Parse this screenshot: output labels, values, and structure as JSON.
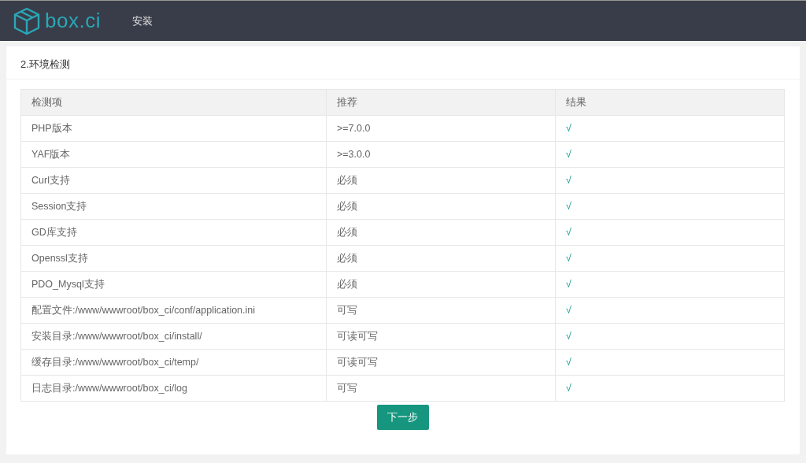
{
  "header": {
    "logo_text": "box.ci",
    "nav": [
      {
        "label": "安装"
      }
    ]
  },
  "panel": {
    "title": "2.环境检测",
    "table": {
      "columns": [
        "检测项",
        "推荐",
        "结果"
      ],
      "rows": [
        {
          "item": "PHP版本",
          "recommended": ">=7.0.0",
          "result": "√"
        },
        {
          "item": "YAF版本",
          "recommended": ">=3.0.0",
          "result": "√"
        },
        {
          "item": "Curl支持",
          "recommended": "必须",
          "result": "√"
        },
        {
          "item": "Session支持",
          "recommended": "必须",
          "result": "√"
        },
        {
          "item": "GD库支持",
          "recommended": "必须",
          "result": "√"
        },
        {
          "item": "Openssl支持",
          "recommended": "必须",
          "result": "√"
        },
        {
          "item": "PDO_Mysql支持",
          "recommended": "必须",
          "result": "√"
        },
        {
          "item": "配置文件:/www/wwwroot/box_ci/conf/application.ini",
          "recommended": "可写",
          "result": "√"
        },
        {
          "item": "安装目录:/www/wwwroot/box_ci/install/",
          "recommended": "可读可写",
          "result": "√"
        },
        {
          "item": "缓存目录:/www/wwwroot/box_ci/temp/",
          "recommended": "可读可写",
          "result": "√"
        },
        {
          "item": "日志目录:/www/wwwroot/box_ci/log",
          "recommended": "可写",
          "result": "√"
        }
      ]
    },
    "button": "下一步"
  }
}
